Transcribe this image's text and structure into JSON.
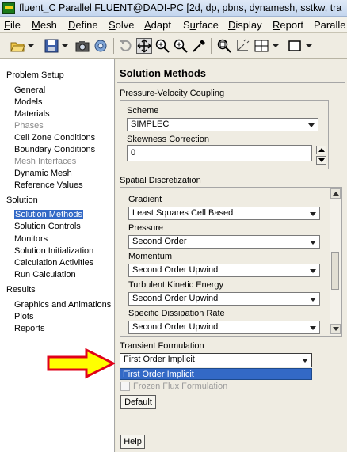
{
  "window": {
    "title": "fluent_C Parallel FLUENT@DADI-PC  [2d, dp, pbns, dynamesh, sstkw, tra"
  },
  "menubar": {
    "items": [
      {
        "label": "File",
        "key": "F"
      },
      {
        "label": "Mesh",
        "key": "M"
      },
      {
        "label": "Define",
        "key": "D"
      },
      {
        "label": "Solve",
        "key": "S"
      },
      {
        "label": "Adapt",
        "key": "A"
      },
      {
        "label": "Surface",
        "key": "u"
      },
      {
        "label": "Display",
        "key": "D"
      },
      {
        "label": "Report",
        "key": "R"
      },
      {
        "label": "Paralle",
        "key": ""
      }
    ]
  },
  "toolbar": {
    "icons": [
      "open-icon",
      "save-icon",
      "camera-icon",
      "gear-icon",
      "rotate-icon",
      "translate-icon",
      "zoom-in-icon",
      "zoom-fit-icon",
      "probe-icon",
      "zoom-area-icon",
      "axes-icon",
      "layout-icon"
    ]
  },
  "tree": {
    "groups": [
      {
        "label": "Problem Setup",
        "items": [
          {
            "label": "General",
            "enabled": true
          },
          {
            "label": "Models",
            "enabled": true
          },
          {
            "label": "Materials",
            "enabled": true
          },
          {
            "label": "Phases",
            "enabled": false
          },
          {
            "label": "Cell Zone Conditions",
            "enabled": true
          },
          {
            "label": "Boundary Conditions",
            "enabled": true
          },
          {
            "label": "Mesh Interfaces",
            "enabled": false
          },
          {
            "label": "Dynamic Mesh",
            "enabled": true
          },
          {
            "label": "Reference Values",
            "enabled": true
          }
        ]
      },
      {
        "label": "Solution",
        "items": [
          {
            "label": "Solution Methods",
            "selected": true
          },
          {
            "label": "Solution Controls"
          },
          {
            "label": "Monitors"
          },
          {
            "label": "Solution Initialization"
          },
          {
            "label": "Calculation Activities"
          },
          {
            "label": "Run Calculation"
          }
        ]
      },
      {
        "label": "Results",
        "items": [
          {
            "label": "Graphics and Animations"
          },
          {
            "label": "Plots"
          },
          {
            "label": "Reports"
          }
        ]
      }
    ]
  },
  "panel": {
    "title": "Solution Methods",
    "pv_coupling": {
      "label": "Pressure-Velocity Coupling",
      "scheme_label": "Scheme",
      "scheme_value": "SIMPLEC",
      "skewness_label": "Skewness Correction",
      "skewness_value": "0"
    },
    "spatial": {
      "label": "Spatial Discretization",
      "rows": [
        {
          "label": "Gradient",
          "value": "Least Squares Cell Based"
        },
        {
          "label": "Pressure",
          "value": "Second Order"
        },
        {
          "label": "Momentum",
          "value": "Second Order Upwind"
        },
        {
          "label": "Turbulent Kinetic Energy",
          "value": "Second Order Upwind"
        },
        {
          "label": "Specific Dissipation Rate",
          "value": "Second Order Upwind"
        }
      ]
    },
    "transient": {
      "label": "Transient Formulation",
      "value": "First Order Implicit",
      "dropdown_option": "First Order Implicit"
    },
    "frozen_flux_label": "Frozen Flux Formulation",
    "default_button": "Default",
    "help_button": "Help"
  },
  "colors": {
    "selection": "#3369c6",
    "arrow_fill": "#ffff00",
    "arrow_stroke": "#e0001a"
  }
}
